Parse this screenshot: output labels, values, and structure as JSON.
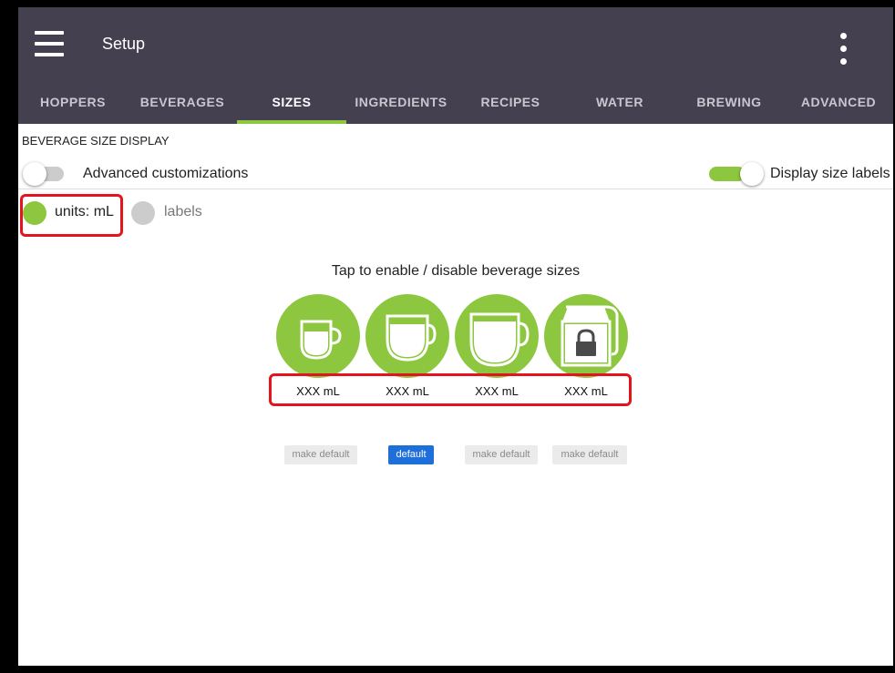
{
  "app": {
    "title": "Setup"
  },
  "tabs": [
    {
      "label": "HOPPERS",
      "active": false
    },
    {
      "label": "BEVERAGES",
      "active": false
    },
    {
      "label": "SIZES",
      "active": true
    },
    {
      "label": "INGREDIENTS",
      "active": false
    },
    {
      "label": "RECIPES",
      "active": false
    },
    {
      "label": "WATER",
      "active": false
    },
    {
      "label": "BREWING",
      "active": false
    },
    {
      "label": "ADVANCED",
      "active": false
    }
  ],
  "section": {
    "title": "BEVERAGE SIZE DISPLAY",
    "advanced_toggle": {
      "label": "Advanced customizations",
      "on": false
    },
    "display_toggle": {
      "label": "Display size labels",
      "on": true
    },
    "mode": {
      "units_label": "units: mL",
      "labels_label": "labels",
      "selected": "units"
    }
  },
  "sizes": {
    "instruction": "Tap to enable / disable beverage sizes",
    "items": [
      {
        "icon": "small-cup-icon",
        "label": "XXX mL",
        "button": "make default",
        "is_default": false
      },
      {
        "icon": "medium-cup-icon",
        "label": "XXX mL",
        "button": "default",
        "is_default": true
      },
      {
        "icon": "large-cup-icon",
        "label": "XXX mL",
        "button": "make default",
        "is_default": false
      },
      {
        "icon": "locked-carafe-icon",
        "label": "XXX mL",
        "button": "make default",
        "is_default": false
      }
    ]
  },
  "colors": {
    "accent": "#8dc63f",
    "app_bar": "#454050",
    "highlight": "#e3141d",
    "default_button": "#1e6fd9"
  }
}
